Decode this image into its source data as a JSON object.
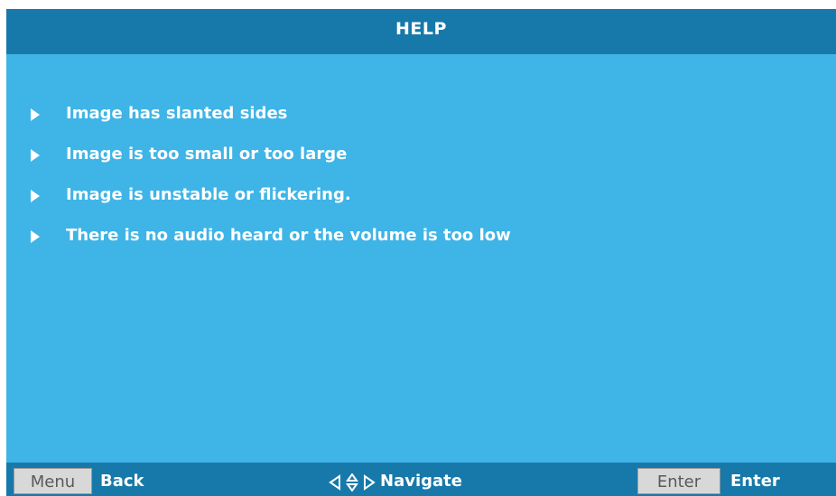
{
  "header": {
    "title": "HELP"
  },
  "help_items": [
    {
      "label": "Image has slanted sides",
      "icon": "triangle-right-icon"
    },
    {
      "label": "Image is too small or too large",
      "icon": "triangle-right-icon"
    },
    {
      "label": "Image is unstable or flickering.",
      "icon": "triangle-right-icon"
    },
    {
      "label": "There is no audio heard or the volume is too low",
      "icon": "triangle-right-icon"
    }
  ],
  "footer": {
    "menu_key": "Menu",
    "back_label": "Back",
    "navigate_icon": "four-way-arrows-icon",
    "navigate_label": "Navigate",
    "enter_key": "Enter",
    "enter_label": "Enter"
  },
  "colors": {
    "panel_background": "#3fb4e6",
    "bar_background": "#1779aa",
    "text": "#ffffff",
    "key_background": "#d8d8d8",
    "key_text": "#5a5a5a"
  }
}
